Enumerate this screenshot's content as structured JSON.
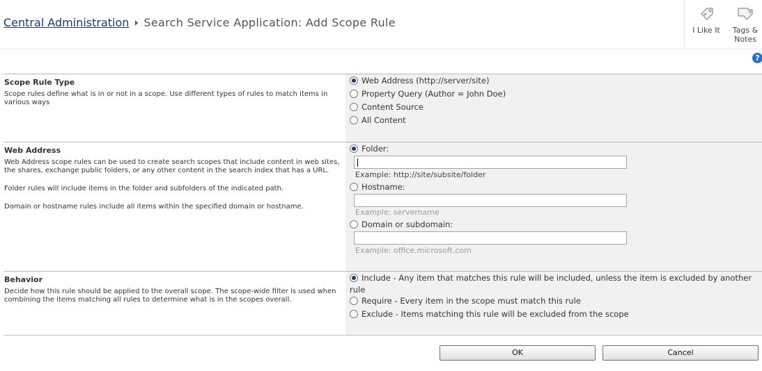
{
  "header": {
    "breadcrumb_link": "Central Administration",
    "page_title": "Search Service Application: Add Scope Rule",
    "social": {
      "like_label": "I Like It",
      "tags_label_line1": "Tags &",
      "tags_label_line2": "Notes"
    },
    "help_label": "?"
  },
  "scope_rule_type": {
    "title": "Scope Rule Type",
    "description": "Scope rules define what is in or not in a scope. Use different types of rules to match items in various ways",
    "options": [
      {
        "label": "Web Address (http://server/site)",
        "checked": true
      },
      {
        "label": "Property Query (Author = John Doe)",
        "checked": false
      },
      {
        "label": "Content Source",
        "checked": false
      },
      {
        "label": "All Content",
        "checked": false
      }
    ]
  },
  "web_address": {
    "title": "Web Address",
    "description_paragraphs": [
      "Web Address scope rules can be used to create search scopes that include content in web sites, the shares, exchange public folders, or any other content in the search index that has a URL.",
      "Folder rules will include items in the folder and subfolders of the indicated path.",
      "Domain or hostname rules include all items within the specified domain or hostname."
    ],
    "folder": {
      "label": "Folder:",
      "checked": true,
      "value": "",
      "example": "Example: http://site/subsite/folder"
    },
    "hostname": {
      "label": "Hostname:",
      "checked": false,
      "value": "",
      "example": "Example: servername"
    },
    "domain": {
      "label": "Domain or subdomain:",
      "checked": false,
      "value": "",
      "example": "Example: office.microsoft.com"
    }
  },
  "behavior": {
    "title": "Behavior",
    "description": "Decide how this rule should be applied to the overall scope. The scope-wide filter is used when combining the items matching all rules to determine what is in the scopes overall.",
    "options": [
      {
        "label": "Include - Any item that matches this rule will be included, unless the item is excluded by another rule",
        "checked": true
      },
      {
        "label": "Require - Every item in the scope must match this rule",
        "checked": false
      },
      {
        "label": "Exclude - Items matching this rule will be excluded from the scope",
        "checked": false
      }
    ]
  },
  "buttons": {
    "ok_label": "OK",
    "cancel_label": "Cancel"
  },
  "colors": {
    "link": "#1b3a6b",
    "options_panel": "#f1f1f1",
    "help_icon": "#2b6fc4"
  }
}
